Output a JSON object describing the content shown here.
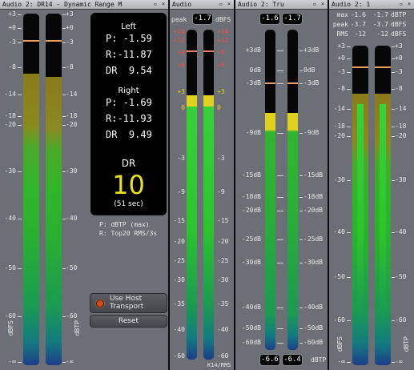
{
  "windows": [
    {
      "title": "Audio 2: DR14 - Dynamic Range M"
    },
    {
      "title": "Audio"
    },
    {
      "title": "Audio 2: Tru"
    },
    {
      "title": "Audio 2: 1"
    }
  ],
  "titlebar_buttons": {
    "close": "×",
    "minimize": "▫"
  },
  "dr14": {
    "left_heading": "Left",
    "left_p": "P: -1.59",
    "left_r": "R:-11.87",
    "left_dr": "DR  9.54",
    "right_heading": "Right",
    "right_p": "P: -1.69",
    "right_r": "R:-11.93",
    "right_dr": "DR  9.49",
    "dr_heading": "DR",
    "dr_value": "10",
    "dr_time": "(51 sec)",
    "legend_p": "P: dBTP (max)",
    "legend_r": "R: Top20 RMS/3s",
    "host_transport_label_1": "Use Host",
    "host_transport_label_2": "Transport",
    "reset_label": "Reset",
    "unit_left": "dBFS",
    "unit_right": "dBTP",
    "scale_left": [
      "+3",
      "+0",
      "-3",
      "-8",
      "-14",
      "-18",
      "-20",
      "-30",
      "-40",
      "-50",
      "-60",
      "-∞"
    ],
    "scale_right": [
      "+3",
      "+0",
      "-3",
      "-8",
      "-14",
      "-18",
      "-20",
      "-30",
      "-40",
      "-50",
      "-60",
      "-∞"
    ],
    "levels": {
      "left_level": 0.83,
      "right_level": 0.82,
      "left_peak": 0.92,
      "right_peak": 0.92
    }
  },
  "k14": {
    "peak_label": "peak",
    "peak_value": "-1.7",
    "unit": "dBFS",
    "bottom_label": "K14/RMS",
    "scale": [
      "+14",
      "+12",
      "+9",
      "+6",
      "+3",
      "0",
      "-3",
      "-9",
      "-15",
      "-20",
      "-25",
      "-30",
      "-35",
      "-40",
      "-60"
    ],
    "levels": {
      "left_level": 0.8,
      "right_level": 0.8
    }
  },
  "truepeak": {
    "top_left_value": "-1.6",
    "top_right_value": "-1.7",
    "bottom_left_value": "-6.6",
    "bottom_right_value": "-6.4",
    "unit": "dBTP",
    "scale": [
      "+3dB",
      "0dB",
      "-3dB",
      "-9dB",
      "-15dB",
      "-18dB",
      "-20dB",
      "-25dB",
      "-30dB",
      "-40dB",
      "-50dB",
      "-60dB"
    ],
    "levels": {
      "left_level": 0.74,
      "right_level": 0.74,
      "left_peak": 0.83,
      "right_peak": 0.83
    }
  },
  "rms": {
    "max_label": "max",
    "max_left": "-1.6",
    "max_right": "-1.7",
    "max_unit": "dBTP",
    "peak_label": "peak",
    "peak_left": "-3.7",
    "peak_right": "-3.7",
    "peak_unit": "dBFS",
    "rms_label": "RMS",
    "rms_left": "-12",
    "rms_right": "-12",
    "rms_unit": "dBFS",
    "unit_left": "dBFS",
    "unit_right": "dBTP",
    "scale_left": [
      "+3",
      "+0",
      "-3",
      "-8",
      "-14",
      "-18",
      "-20",
      "-30",
      "-40",
      "-50",
      "-60",
      "-∞"
    ],
    "scale_right": [
      "+3",
      "+0",
      "-3",
      "-8",
      "-14",
      "-18",
      "-20",
      "-30",
      "-40",
      "-50",
      "-60",
      "-∞"
    ],
    "levels": {
      "left_level": 0.85,
      "right_level": 0.85,
      "left_peak": 0.93,
      "right_peak": 0.93
    }
  }
}
